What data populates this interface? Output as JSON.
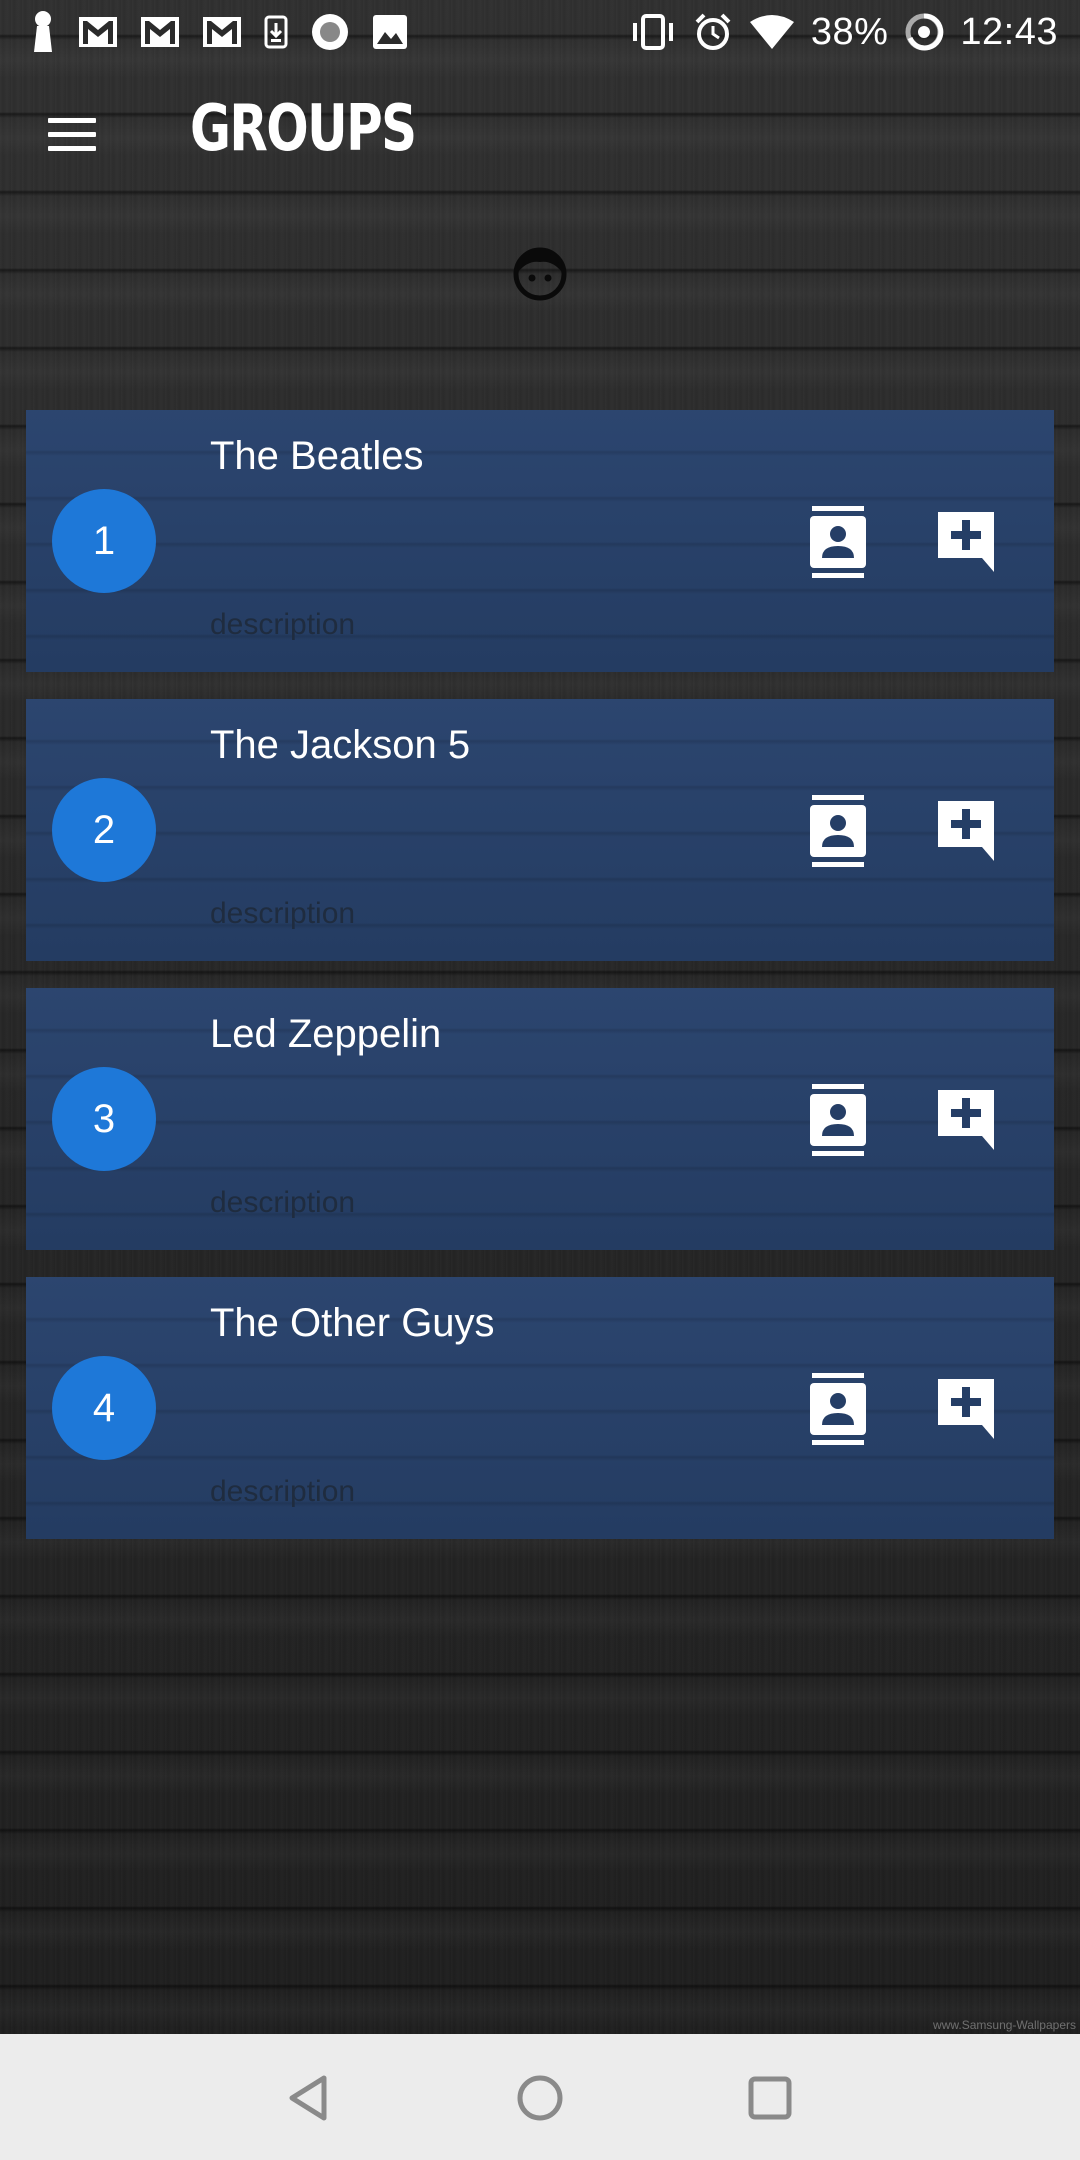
{
  "status_bar": {
    "battery_percent": "38%",
    "time": "12:43",
    "left_icons": [
      "keyhole-icon",
      "gmail-icon",
      "gmail-icon",
      "gmail-icon",
      "download-icon",
      "circle-dot-icon",
      "image-icon"
    ],
    "right_icons": [
      "vibrate-icon",
      "alarm-icon",
      "wifi-icon",
      "battery-icon",
      "data-saver-icon"
    ]
  },
  "app_bar": {
    "title": "GROUPS",
    "menu_icon": "hamburger-icon"
  },
  "avatar_icon": "face-icon",
  "groups": [
    {
      "number": "1",
      "name": "The Beatles",
      "description": "description"
    },
    {
      "number": "2",
      "name": "The Jackson 5",
      "description": "description"
    },
    {
      "number": "3",
      "name": "Led Zeppelin",
      "description": "description"
    },
    {
      "number": "4",
      "name": "The Other Guys",
      "description": "description"
    }
  ],
  "watermark": "www.Samsung-Wallpapers",
  "colors": {
    "accent_circle": "#1e78d8",
    "card_background": "#253e66",
    "nav_bar": "#ececec"
  },
  "nav_bar": {
    "icons": [
      "back-icon",
      "home-icon",
      "recents-icon"
    ]
  }
}
